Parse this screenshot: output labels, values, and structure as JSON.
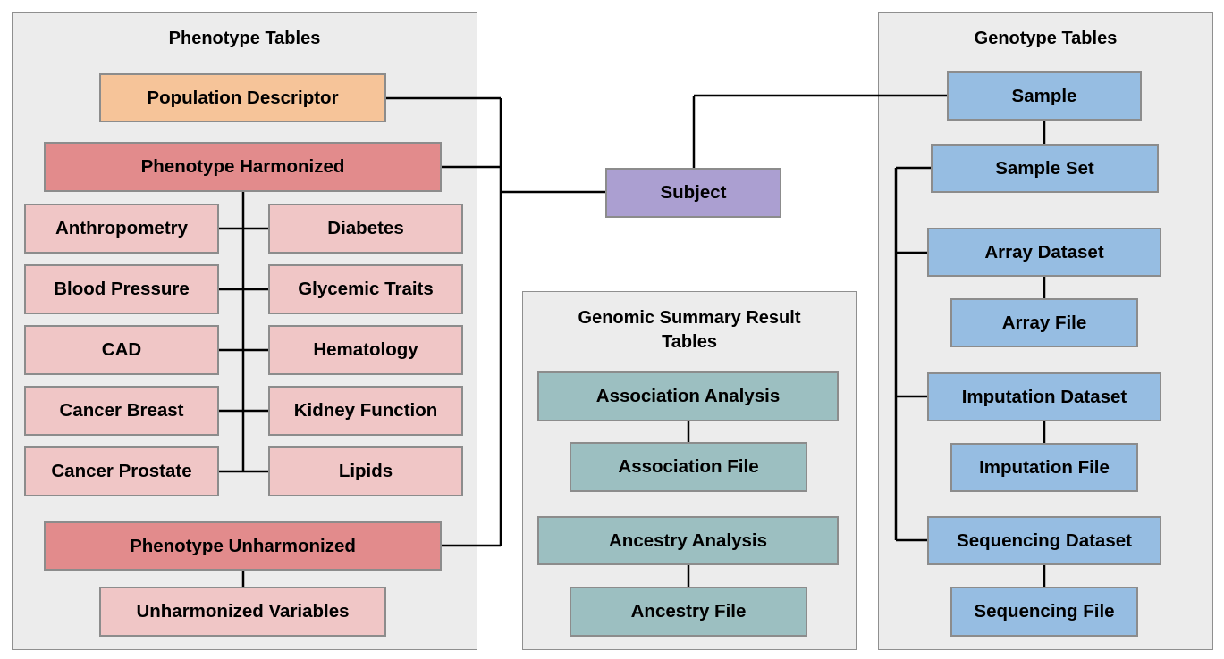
{
  "panels": {
    "phenotype": {
      "title": "Phenotype Tables"
    },
    "genomic": {
      "title": "Genomic Summary Result Tables"
    },
    "genotype": {
      "title": "Genotype Tables"
    }
  },
  "boxes": {
    "population_descriptor": "Population Descriptor",
    "phenotype_harmonized": "Phenotype Harmonized",
    "anthropometry": "Anthropometry",
    "diabetes": "Diabetes",
    "blood_pressure": "Blood Pressure",
    "glycemic_traits": "Glycemic Traits",
    "cad": "CAD",
    "hematology": "Hematology",
    "cancer_breast": "Cancer Breast",
    "kidney_function": "Kidney Function",
    "cancer_prostate": "Cancer Prostate",
    "lipids": "Lipids",
    "phenotype_unharmonized": "Phenotype Unharmonized",
    "unharmonized_variables": "Unharmonized Variables",
    "subject": "Subject",
    "association_analysis": "Association Analysis",
    "association_file": "Association File",
    "ancestry_analysis": "Ancestry Analysis",
    "ancestry_file": "Ancestry File",
    "sample": "Sample",
    "sample_set": "Sample Set",
    "array_dataset": "Array Dataset",
    "array_file": "Array File",
    "imputation_dataset": "Imputation Dataset",
    "imputation_file": "Imputation File",
    "sequencing_dataset": "Sequencing Dataset",
    "sequencing_file": "Sequencing File"
  },
  "colors": {
    "panel": "#ececec",
    "population": "#f6c499",
    "phenotype_dark": "#e28b8c",
    "phenotype_light": "#f0c6c6",
    "subject": "#ab9fd1",
    "genomic": "#9cbfc1",
    "genotype": "#96bde2"
  }
}
